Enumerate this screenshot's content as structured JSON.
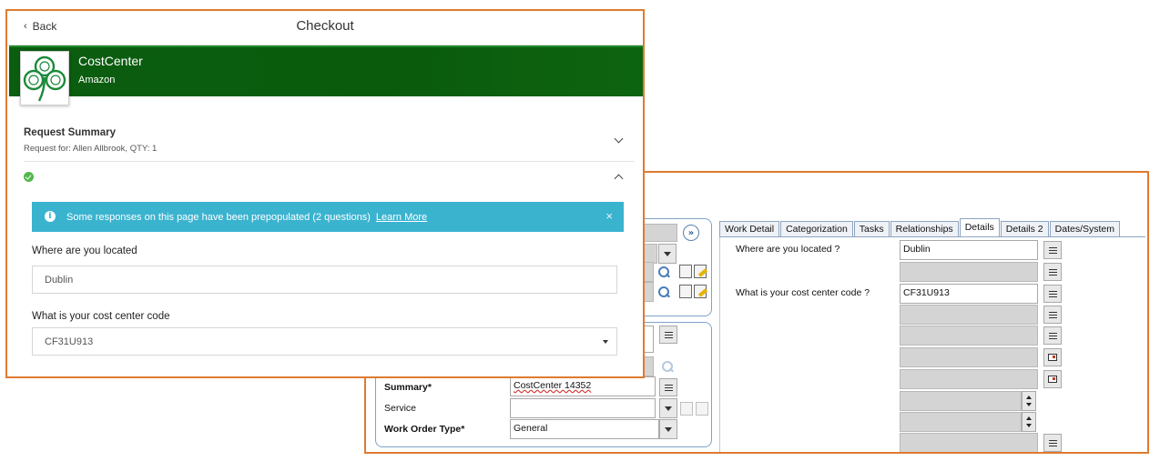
{
  "back_window": {
    "tabs": [
      {
        "label": "Work Detail",
        "active": false
      },
      {
        "label": "Categorization",
        "active": false
      },
      {
        "label": "Tasks",
        "active": false
      },
      {
        "label": "Relationships",
        "active": false
      },
      {
        "label": "Details",
        "active": true
      },
      {
        "label": "Details 2",
        "active": false
      },
      {
        "label": "Dates/System",
        "active": false
      }
    ],
    "details": {
      "q1_label": "Where are you located ?",
      "q1_value": "Dublin",
      "q2_label": "What is your cost center code ?",
      "q2_value": "CF31U913"
    },
    "left_form": {
      "summary_label": "Summary*",
      "summary_value": "CostCenter 14352",
      "service_label": "Service",
      "service_value": "",
      "work_order_type_label": "Work Order Type*",
      "work_order_type_value": "General"
    },
    "expand_button": "»"
  },
  "front_window": {
    "back_label": "Back",
    "title": "Checkout",
    "banner": {
      "title": "CostCenter",
      "subtitle": "Amazon"
    },
    "request_summary": {
      "title": "Request Summary",
      "subtitle": "Request for: Allen Allbrook, QTY: 1"
    },
    "info_bar": {
      "message": "Some responses on this page have been prepopulated (2 questions)",
      "link": "Learn More"
    },
    "questions": [
      {
        "label": "Where are you located",
        "value": "Dublin"
      },
      {
        "label": "What is your cost center code",
        "value": "CF31U913"
      }
    ]
  },
  "colors": {
    "accent_border": "#e07a30",
    "banner_green": "#0b5d10",
    "info_blue": "#3ab3cf"
  }
}
